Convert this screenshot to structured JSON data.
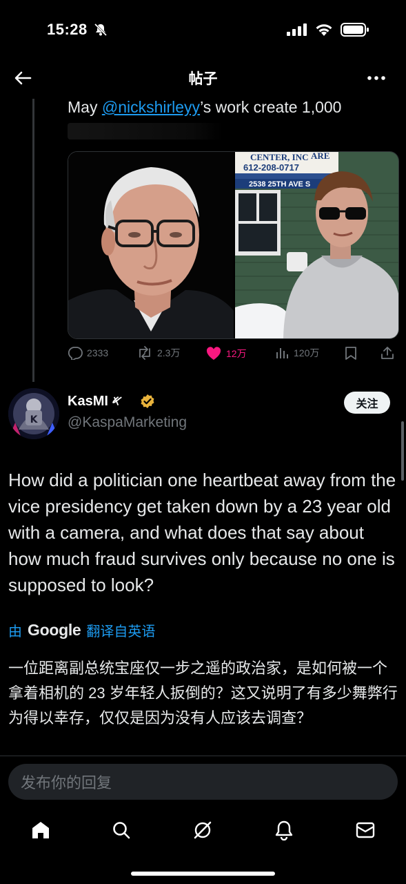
{
  "status_bar": {
    "time": "15:28"
  },
  "header": {
    "title": "帖子"
  },
  "quoted": {
    "prefix": "May ",
    "mention": "@nickshirleyy",
    "suffix": "’s work create 1,000",
    "sign": {
      "line1": "CENTER, INC",
      "line2": "612-208-0717",
      "line3": "2538 25TH AVE S",
      "corner": "ARE"
    },
    "actions": {
      "replies": "2333",
      "reposts": "2.3万",
      "likes": "12万",
      "views": "120万"
    }
  },
  "tweet": {
    "display_name": "KasMI",
    "name_glyph": "𐤀",
    "handle": "@KaspaMarketing",
    "follow_label": "关注",
    "body": "How did a politician one heartbeat away from the vice presidency get taken down by a 23 year old with a camera, and what does that say about how much fraud survives only because no one is supposed to look?",
    "translated_by": "由",
    "translator": "Google",
    "translated_from": "翻译自英语",
    "translated_text": "一位距离副总统宝座仅一步之遥的政治家，是如何被一个拿着相机的 23 岁年轻人扳倒的？这又说明了有多少舞弊行为得以幸存，仅仅是因为没有人应该去调查？"
  },
  "reply": {
    "placeholder": "发布你的回复"
  },
  "colors": {
    "accent": "#1d9bf0",
    "like": "#f91880",
    "muted": "#71767b",
    "verified": "#e9b33c"
  }
}
